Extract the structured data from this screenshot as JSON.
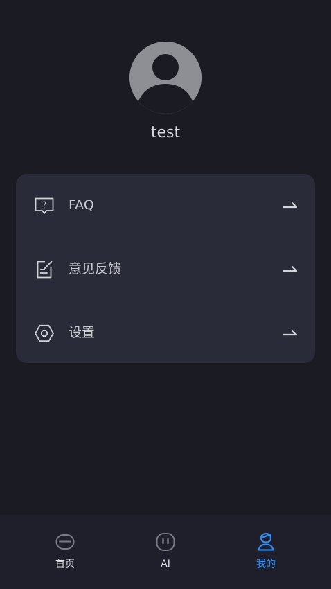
{
  "profile": {
    "username": "test",
    "avatar_icon": "default-user-avatar-icon"
  },
  "menu": {
    "items": [
      {
        "label": "FAQ",
        "icon": "faq-question-bubble-icon"
      },
      {
        "label": "意见反馈",
        "icon": "feedback-edit-icon"
      },
      {
        "label": "设置",
        "icon": "settings-hexagon-icon"
      }
    ],
    "arrow_icon": "arrow-right-icon"
  },
  "tabbar": {
    "active_index": 2,
    "active_color": "#2f8cf0",
    "tabs": [
      {
        "label": "首页",
        "icon": "home-icon"
      },
      {
        "label": "AI",
        "icon": "ai-robot-icon"
      },
      {
        "label": "我的",
        "icon": "profile-user-icon"
      }
    ]
  },
  "colors": {
    "background": "#1b1b23",
    "card": "#2a2b38",
    "tabbar": "#1e1f2b",
    "text": "#c9cad1"
  }
}
